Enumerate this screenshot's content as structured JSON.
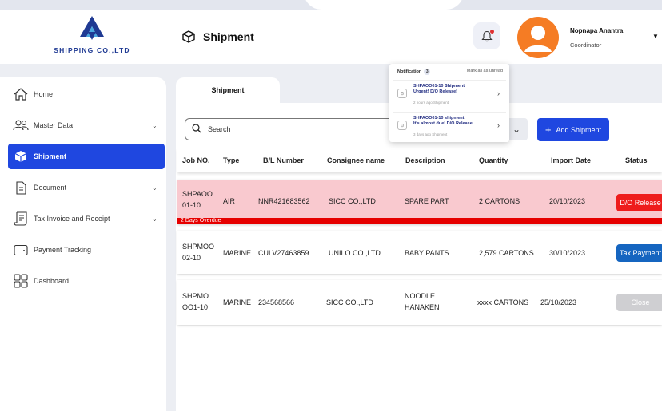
{
  "brand": {
    "logo_text": "SHIPPING CO.,LTD"
  },
  "header": {
    "page_title": "Shipment",
    "user_name": "Nopnapa Anantra",
    "user_role": "Coordinator"
  },
  "sidebar": {
    "items": [
      {
        "label": "Home",
        "icon": "home-icon",
        "has_chevron": false
      },
      {
        "label": "Master Data",
        "icon": "users-icon",
        "has_chevron": true
      },
      {
        "label": "Shipment",
        "icon": "box-icon",
        "has_chevron": false,
        "active": true
      },
      {
        "label": "Document",
        "icon": "document-icon",
        "has_chevron": true
      },
      {
        "label": "Tax Invoice and Receipt",
        "icon": "receipt-icon",
        "has_chevron": true
      },
      {
        "label": "Payment Tracking",
        "icon": "wallet-icon",
        "has_chevron": false
      },
      {
        "label": "Dashboard",
        "icon": "dashboard-icon",
        "has_chevron": false
      }
    ]
  },
  "main": {
    "tab_label": "Shipment",
    "search_placeholder": "Search",
    "add_button": "Add Shipment",
    "columns": [
      "Job NO.",
      "Type",
      "B/L Number",
      "Consignee name",
      "Description",
      "Quantity",
      "Import Date",
      "Status"
    ],
    "rows": [
      {
        "job_no_1": "SHPAOO",
        "job_no_2": "01-10",
        "type": "AIR",
        "bl_number": "NNR421683562",
        "consignee": "SICC CO.,LTD",
        "description_1": "SPARE PART",
        "description_2": "",
        "quantity": "2 CARTONS",
        "import_date": "20/10/2023",
        "status": "D/O Release",
        "status_color": "#ee1c1c",
        "overdue": "2 Days Overdue"
      },
      {
        "job_no_1": "SHPMOO",
        "job_no_2": "02-10",
        "type": "MARINE",
        "bl_number": "CULV27463859",
        "consignee": "UNILO CO.,LTD",
        "description_1": "BABY PANTS",
        "description_2": "",
        "quantity": "2,579 CARTONS",
        "import_date": "30/10/2023",
        "status": "Tax Payment",
        "status_color": "#1565c0"
      },
      {
        "job_no_1": "SHPMO",
        "job_no_2": "OO1-10",
        "type": "MARINE",
        "bl_number": "234568566",
        "consignee": "SICC CO.,LTD",
        "description_1": "NOODLE",
        "description_2": "HANAKEN",
        "quantity": "xxxx CARTONS",
        "import_date": "25/10/2023",
        "status": "Close",
        "status_color": "#cfcfd2"
      }
    ]
  },
  "notifications": {
    "title": "Notification",
    "count": "3",
    "mark_all": "Mark all as unread",
    "items": [
      {
        "title_1": "SHPAOO01-10 Shipment",
        "title_2": "Urgent!  D/O Release!",
        "meta": "2 hours ago  Shipment"
      },
      {
        "title_1": "SHPAOO01-10 shipment",
        "title_2": "It's almost due! D/O Release",
        "meta": "3 days ago  Shipment"
      }
    ]
  },
  "colors": {
    "primary": "#1f47e0",
    "overdue_row": "#f9c9cf",
    "overdue_bar": "#e60000",
    "avatar": "#f57c24"
  }
}
